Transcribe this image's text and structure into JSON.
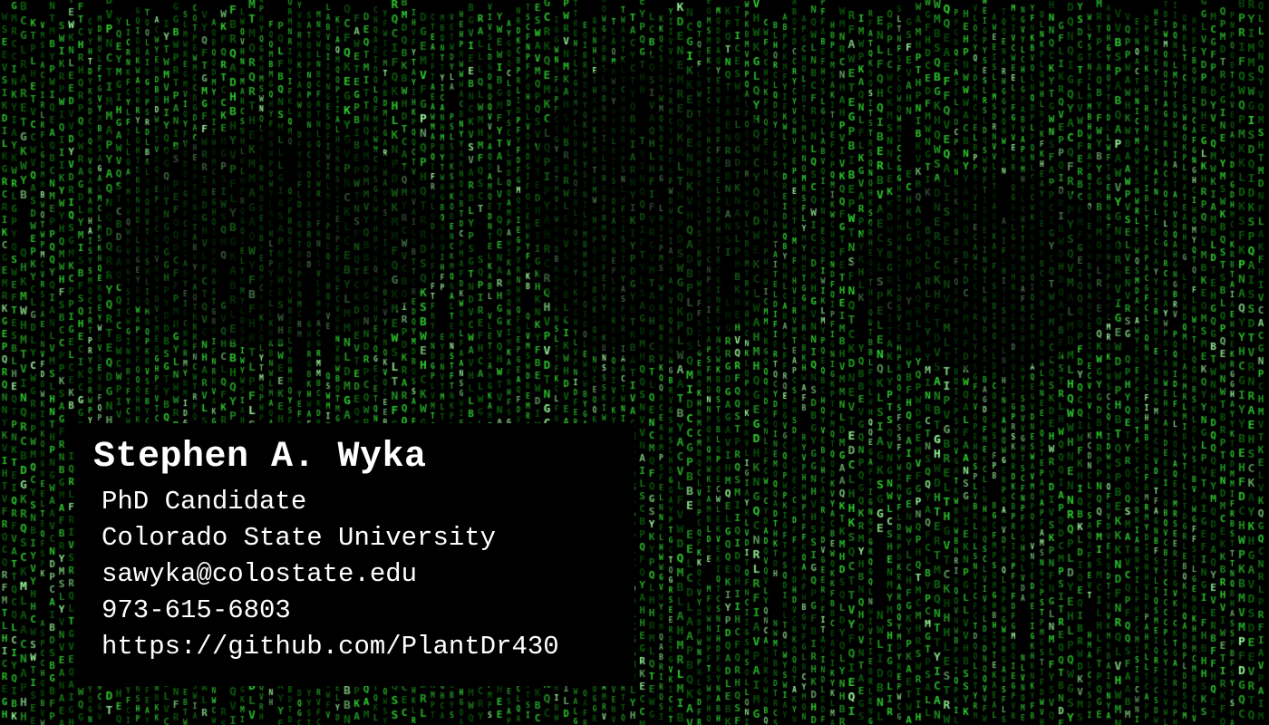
{
  "card": {
    "name": "Stephen A. Wyka",
    "title": "PhD Candidate",
    "affiliation": "Colorado State University",
    "email": "sawyka@colostate.edu",
    "phone": "973-615-6803",
    "url": "https://github.com/PlantDr430"
  },
  "theme": {
    "background": "#000000",
    "rain_bright": "#9cff9c",
    "rain_mid": "#2fd12f",
    "rain_dim": "#0f6e0f",
    "text": "#ffffff"
  }
}
